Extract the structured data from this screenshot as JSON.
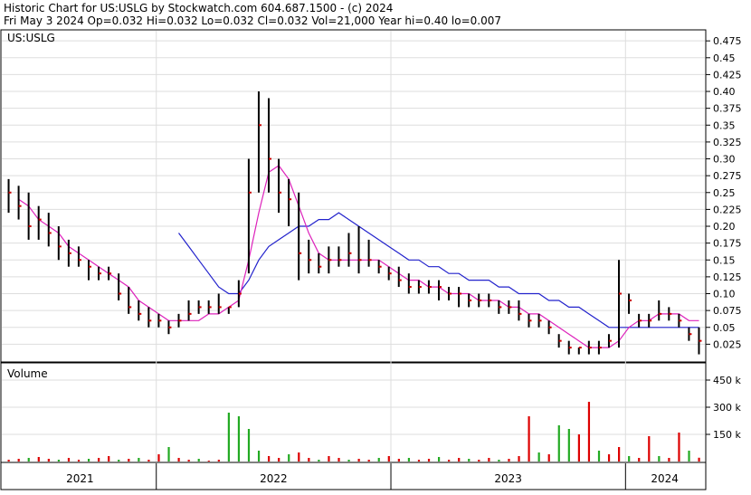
{
  "header": {
    "line1": "Historic Chart for US:USLG by Stockwatch.com 604.687.1500 - (c) 2024",
    "line2": "Fri May  3 2024   Op=0.032   Hi=0.032   Lo=0.032   Cl=0.032   Vol=21,000   Year hi=0.40   lo=0.007"
  },
  "price_panel": {
    "label": "US:USLG"
  },
  "volume_panel": {
    "label": "Volume"
  },
  "colors": {
    "price_bar": "#000000",
    "close_tick": "#cc0000",
    "ma_short": "#dd22bb",
    "ma_long": "#2222cc",
    "volume_up": "#22aa22",
    "volume_down": "#dd0000",
    "grid": "#dddddd"
  },
  "chart_data": [
    {
      "type": "line",
      "title": "Historic Chart for US:USLG",
      "series_label": "US:USLG",
      "ylim": [
        0.0,
        0.49
      ],
      "y_ticks": [
        "0.475",
        "0.45",
        "0.425",
        "0.40",
        "0.375",
        "0.35",
        "0.325",
        "0.30",
        "0.275",
        "0.25",
        "0.225",
        "0.20",
        "0.175",
        "0.15",
        "0.125",
        "0.10",
        "0.075",
        "0.05",
        "0.025"
      ],
      "x_labels": [
        "2021",
        "2022",
        "2023",
        "2024"
      ],
      "grid": true,
      "price_bars": [
        [
          0.27,
          0.22,
          0.25
        ],
        [
          0.26,
          0.21,
          0.23
        ],
        [
          0.25,
          0.18,
          0.2
        ],
        [
          0.23,
          0.18,
          0.21
        ],
        [
          0.22,
          0.17,
          0.19
        ],
        [
          0.2,
          0.15,
          0.17
        ],
        [
          0.18,
          0.14,
          0.16
        ],
        [
          0.17,
          0.14,
          0.15
        ],
        [
          0.15,
          0.12,
          0.14
        ],
        [
          0.14,
          0.12,
          0.13
        ],
        [
          0.14,
          0.12,
          0.13
        ],
        [
          0.13,
          0.09,
          0.1
        ],
        [
          0.11,
          0.07,
          0.08
        ],
        [
          0.09,
          0.06,
          0.07
        ],
        [
          0.08,
          0.05,
          0.06
        ],
        [
          0.07,
          0.05,
          0.06
        ],
        [
          0.06,
          0.04,
          0.05
        ],
        [
          0.07,
          0.05,
          0.06
        ],
        [
          0.09,
          0.06,
          0.07
        ],
        [
          0.09,
          0.07,
          0.08
        ],
        [
          0.09,
          0.07,
          0.08
        ],
        [
          0.1,
          0.07,
          0.08
        ],
        [
          0.08,
          0.07,
          0.08
        ],
        [
          0.12,
          0.08,
          0.1
        ],
        [
          0.3,
          0.13,
          0.25
        ],
        [
          0.4,
          0.25,
          0.35
        ],
        [
          0.39,
          0.25,
          0.3
        ],
        [
          0.3,
          0.22,
          0.25
        ],
        [
          0.27,
          0.2,
          0.24
        ],
        [
          0.25,
          0.12,
          0.16
        ],
        [
          0.18,
          0.13,
          0.15
        ],
        [
          0.16,
          0.13,
          0.14
        ],
        [
          0.17,
          0.13,
          0.15
        ],
        [
          0.17,
          0.14,
          0.15
        ],
        [
          0.19,
          0.14,
          0.16
        ],
        [
          0.2,
          0.13,
          0.15
        ],
        [
          0.18,
          0.14,
          0.15
        ],
        [
          0.15,
          0.13,
          0.14
        ],
        [
          0.14,
          0.12,
          0.13
        ],
        [
          0.14,
          0.11,
          0.12
        ],
        [
          0.13,
          0.1,
          0.11
        ],
        [
          0.12,
          0.1,
          0.11
        ],
        [
          0.12,
          0.1,
          0.11
        ],
        [
          0.12,
          0.09,
          0.11
        ],
        [
          0.11,
          0.09,
          0.1
        ],
        [
          0.11,
          0.08,
          0.1
        ],
        [
          0.1,
          0.08,
          0.09
        ],
        [
          0.1,
          0.08,
          0.09
        ],
        [
          0.1,
          0.08,
          0.09
        ],
        [
          0.09,
          0.07,
          0.08
        ],
        [
          0.09,
          0.07,
          0.08
        ],
        [
          0.09,
          0.06,
          0.07
        ],
        [
          0.07,
          0.05,
          0.06
        ],
        [
          0.07,
          0.05,
          0.06
        ],
        [
          0.06,
          0.04,
          0.05
        ],
        [
          0.04,
          0.02,
          0.03
        ],
        [
          0.03,
          0.01,
          0.02
        ],
        [
          0.02,
          0.01,
          0.02
        ],
        [
          0.03,
          0.01,
          0.02
        ],
        [
          0.03,
          0.01,
          0.02
        ],
        [
          0.04,
          0.02,
          0.03
        ],
        [
          0.15,
          0.02,
          0.1
        ],
        [
          0.1,
          0.07,
          0.09
        ],
        [
          0.07,
          0.05,
          0.06
        ],
        [
          0.07,
          0.05,
          0.06
        ],
        [
          0.09,
          0.06,
          0.07
        ],
        [
          0.08,
          0.06,
          0.07
        ],
        [
          0.07,
          0.05,
          0.06
        ],
        [
          0.05,
          0.03,
          0.04
        ],
        [
          0.05,
          0.01,
          0.03
        ]
      ],
      "ma_short": [
        null,
        0.24,
        0.23,
        0.21,
        0.2,
        0.19,
        0.17,
        0.16,
        0.15,
        0.14,
        0.13,
        0.12,
        0.11,
        0.09,
        0.08,
        0.07,
        0.06,
        0.06,
        0.06,
        0.06,
        0.07,
        0.07,
        0.08,
        0.09,
        0.15,
        0.22,
        0.28,
        0.29,
        0.27,
        0.23,
        0.19,
        0.16,
        0.15,
        0.15,
        0.15,
        0.15,
        0.15,
        0.15,
        0.14,
        0.13,
        0.12,
        0.12,
        0.11,
        0.11,
        0.1,
        0.1,
        0.1,
        0.09,
        0.09,
        0.09,
        0.08,
        0.08,
        0.07,
        0.07,
        0.06,
        0.05,
        0.04,
        0.03,
        0.02,
        0.02,
        0.02,
        0.03,
        0.05,
        0.06,
        0.06,
        0.07,
        0.07,
        0.07,
        0.06,
        0.06
      ],
      "ma_long": [
        null,
        null,
        null,
        null,
        null,
        null,
        null,
        null,
        null,
        null,
        null,
        null,
        null,
        null,
        null,
        null,
        null,
        0.19,
        0.17,
        0.15,
        0.13,
        0.11,
        0.1,
        0.1,
        0.12,
        0.15,
        0.17,
        0.18,
        0.19,
        0.2,
        0.2,
        0.21,
        0.21,
        0.22,
        0.21,
        0.2,
        0.19,
        0.18,
        0.17,
        0.16,
        0.15,
        0.15,
        0.14,
        0.14,
        0.13,
        0.13,
        0.12,
        0.12,
        0.12,
        0.11,
        0.11,
        0.1,
        0.1,
        0.1,
        0.09,
        0.09,
        0.08,
        0.08,
        0.07,
        0.06,
        0.05,
        0.05,
        0.05,
        0.05,
        0.05,
        0.05,
        0.05,
        0.05,
        0.05,
        0.05
      ]
    },
    {
      "type": "bar",
      "title": "Volume",
      "ylim": [
        0,
        520
      ],
      "y_ticks": [
        "450 k",
        "300 k",
        "150 k"
      ],
      "values": [
        10,
        15,
        20,
        25,
        15,
        10,
        20,
        10,
        15,
        20,
        30,
        10,
        15,
        20,
        10,
        40,
        80,
        20,
        10,
        15,
        5,
        10,
        270,
        250,
        180,
        60,
        30,
        20,
        40,
        50,
        20,
        10,
        30,
        20,
        10,
        15,
        10,
        20,
        30,
        15,
        20,
        10,
        15,
        25,
        10,
        20,
        15,
        10,
        20,
        10,
        15,
        30,
        250,
        50,
        40,
        200,
        180,
        150,
        330,
        60,
        40,
        80,
        30,
        20,
        140,
        30,
        20,
        160,
        60,
        21
      ],
      "up": [
        false,
        false,
        true,
        false,
        false,
        true,
        false,
        false,
        true,
        false,
        false,
        true,
        false,
        true,
        false,
        false,
        true,
        false,
        false,
        true,
        false,
        false,
        true,
        true,
        true,
        true,
        false,
        false,
        true,
        false,
        false,
        true,
        false,
        false,
        true,
        false,
        false,
        true,
        false,
        false,
        true,
        false,
        false,
        true,
        false,
        false,
        true,
        false,
        false,
        true,
        false,
        false,
        false,
        true,
        false,
        true,
        true,
        false,
        false,
        true,
        false,
        false,
        true,
        false,
        false,
        true,
        false,
        false,
        true,
        false
      ]
    }
  ]
}
